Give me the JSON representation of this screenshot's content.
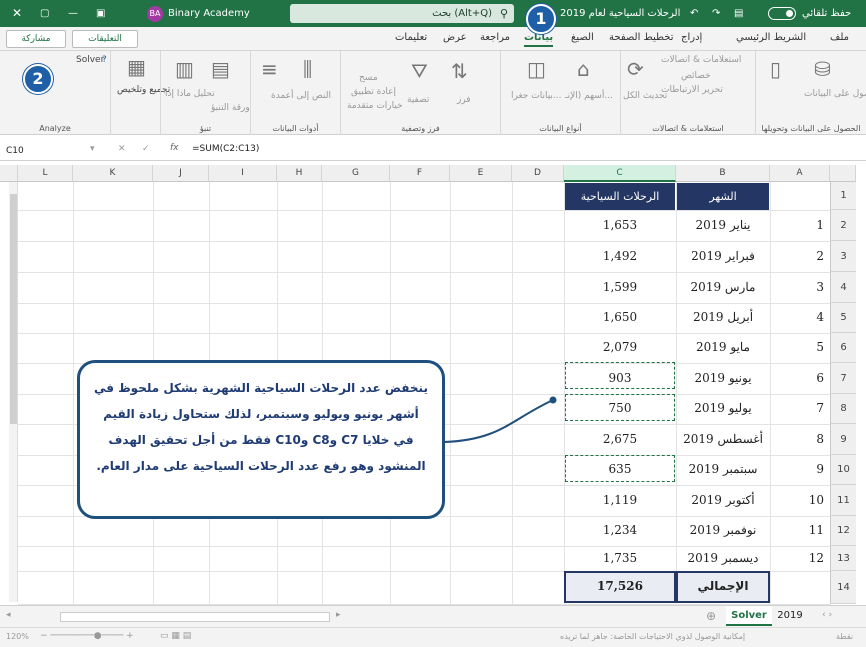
{
  "titlebar": {
    "autosave": "حفظ تلقائي",
    "doc_title": "الرحلات السياحية لعام 2019",
    "search": "بحث (Alt+Q)",
    "user": "Binary Academy",
    "user_initials": "BA"
  },
  "tabs": [
    "ملف",
    "الشريط الرئيسي",
    "إدراج",
    "تخطيط الصفحة",
    "الصيغ",
    "بيانات",
    "مراجعة",
    "عرض",
    "تعليمات"
  ],
  "tabs_right": {
    "comments": "التعليقات",
    "share": "مشاركة"
  },
  "ribbon": {
    "groups": [
      {
        "label": "الحصول على البيانات وتحويلها",
        "items": [
          "الحصول على البيانات"
        ]
      },
      {
        "label": "استعلامات & اتصالات",
        "items": [
          "استعلامات & اتصالات",
          "خصائص",
          "تحرير الارتباطات",
          "تحديث الكل"
        ]
      },
      {
        "label": "أنواع البيانات",
        "items": [
          "أسهم (الإنـ...",
          "بيانات جغرا..."
        ]
      },
      {
        "label": "فرز وتصفية",
        "items": [
          "فرز",
          "تصفية",
          "مسح",
          "إعادة تطبيق",
          "خيارات متقدمة"
        ]
      },
      {
        "label": "أدوات البيانات",
        "items": [
          "النص إلى أعمدة"
        ]
      },
      {
        "label": "تنبؤ",
        "items": [
          "تحليل ماذا إذا",
          "ورقة التنبؤ"
        ]
      },
      {
        "label": "",
        "items": [
          "تجميع وتلخيص"
        ]
      },
      {
        "label": "Analyze",
        "items": [
          "Solver"
        ]
      }
    ]
  },
  "formula_bar": {
    "name_box": "C10",
    "fx": "fx",
    "formula": "=SUM(C2:C13)"
  },
  "columns": [
    "A",
    "B",
    "C",
    "D",
    "E",
    "F",
    "G",
    "H",
    "I",
    "J",
    "K",
    "L"
  ],
  "rows": [
    "1",
    "2",
    "3",
    "4",
    "5",
    "6",
    "7",
    "8",
    "9",
    "10",
    "11",
    "12",
    "13",
    "14"
  ],
  "table": {
    "header_month": "الشهر",
    "header_trips": "الرحلات السياحية",
    "rows": [
      {
        "n": "1",
        "month": "يناير 2019",
        "trips": "1,653"
      },
      {
        "n": "2",
        "month": "فبراير 2019",
        "trips": "1,492"
      },
      {
        "n": "3",
        "month": "مارس 2019",
        "trips": "1,599"
      },
      {
        "n": "4",
        "month": "أبريل 2019",
        "trips": "1,650"
      },
      {
        "n": "5",
        "month": "مايو 2019",
        "trips": "2,079"
      },
      {
        "n": "6",
        "month": "يونيو 2019",
        "trips": "903"
      },
      {
        "n": "7",
        "month": "يوليو 2019",
        "trips": "750"
      },
      {
        "n": "8",
        "month": "أغسطس 2019",
        "trips": "2,675"
      },
      {
        "n": "9",
        "month": "سبتمبر 2019",
        "trips": "635"
      },
      {
        "n": "10",
        "month": "أكتوبر 2019",
        "trips": "1,119"
      },
      {
        "n": "11",
        "month": "نوفمبر 2019",
        "trips": "1,234"
      },
      {
        "n": "12",
        "month": "ديسمبر 2019",
        "trips": "1,735"
      }
    ],
    "total_label": "الإجمالي",
    "total_value": "17,526"
  },
  "callout": "ينخفض عدد الرحلات السياحية الشهرية بشكل ملحوظ في أشهر يونيو ويوليو وسبتمبر، لذلك ستحاول زيادة القيم في خلايا C7 وC8 وC10 فقط من أجل تحقيق الهدف المنشود وهو رفع عدد الرحلات السياحية على مدار العام.",
  "steps": [
    "1",
    "2"
  ],
  "sheets": [
    "2019",
    "Solver"
  ],
  "status": {
    "left": "نقطة",
    "accessibility": "إمكانية الوصول لذوي الاحتياجات الخاصة: جاهز لما تريده",
    "zoom": "120%"
  },
  "colors": {
    "excel_green": "#217346",
    "header_navy": "#243764",
    "callout_border": "#1f4f7d",
    "step_blue": "#1f5fa8"
  }
}
